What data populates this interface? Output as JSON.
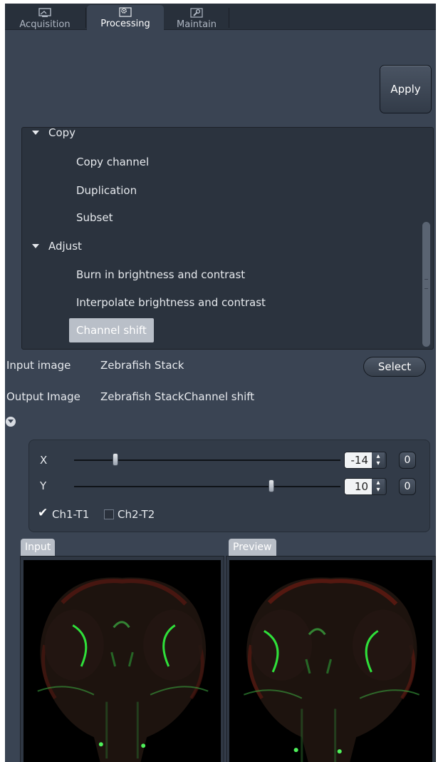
{
  "tabs": [
    {
      "label": "Acquisition",
      "icon": "microscope-icon",
      "active": false
    },
    {
      "label": "Processing",
      "icon": "gear-icon",
      "active": true
    },
    {
      "label": "Maintain",
      "icon": "wrench-icon",
      "active": false
    }
  ],
  "toolbar": {
    "apply_label": "Apply"
  },
  "method_tree": {
    "categories": [
      {
        "label": "Copy",
        "expanded": true,
        "items": [
          "Copy channel",
          "Duplication",
          "Subset"
        ]
      },
      {
        "label": "Adjust",
        "expanded": true,
        "items": [
          "Burn in brightness and contrast",
          "Interpolate brightness and contrast",
          "Channel shift"
        ]
      }
    ],
    "selected": "Channel shift"
  },
  "images": {
    "input_label": "Input image",
    "input_value": "Zebrafish Stack",
    "select_label": "Select",
    "output_label": "Output Image",
    "output_value": "Zebrafish StackChannel shift"
  },
  "shift": {
    "x": {
      "label": "X",
      "value": "-14",
      "reset_label": "0"
    },
    "y": {
      "label": "Y",
      "value": "10",
      "reset_label": "0"
    }
  },
  "channels": [
    {
      "label": "Ch1-T1",
      "checked": true
    },
    {
      "label": "Ch2-T2",
      "checked": false
    }
  ],
  "viewers": {
    "input_label": "Input",
    "preview_label": "Preview"
  },
  "colors": {
    "background": "#3a4453",
    "tab_bar": "#28303b",
    "tree_bg": "#2b333e",
    "selection": "#b9bfc8",
    "green_channel": "#2fe03a",
    "red_channel": "#b8261c"
  }
}
